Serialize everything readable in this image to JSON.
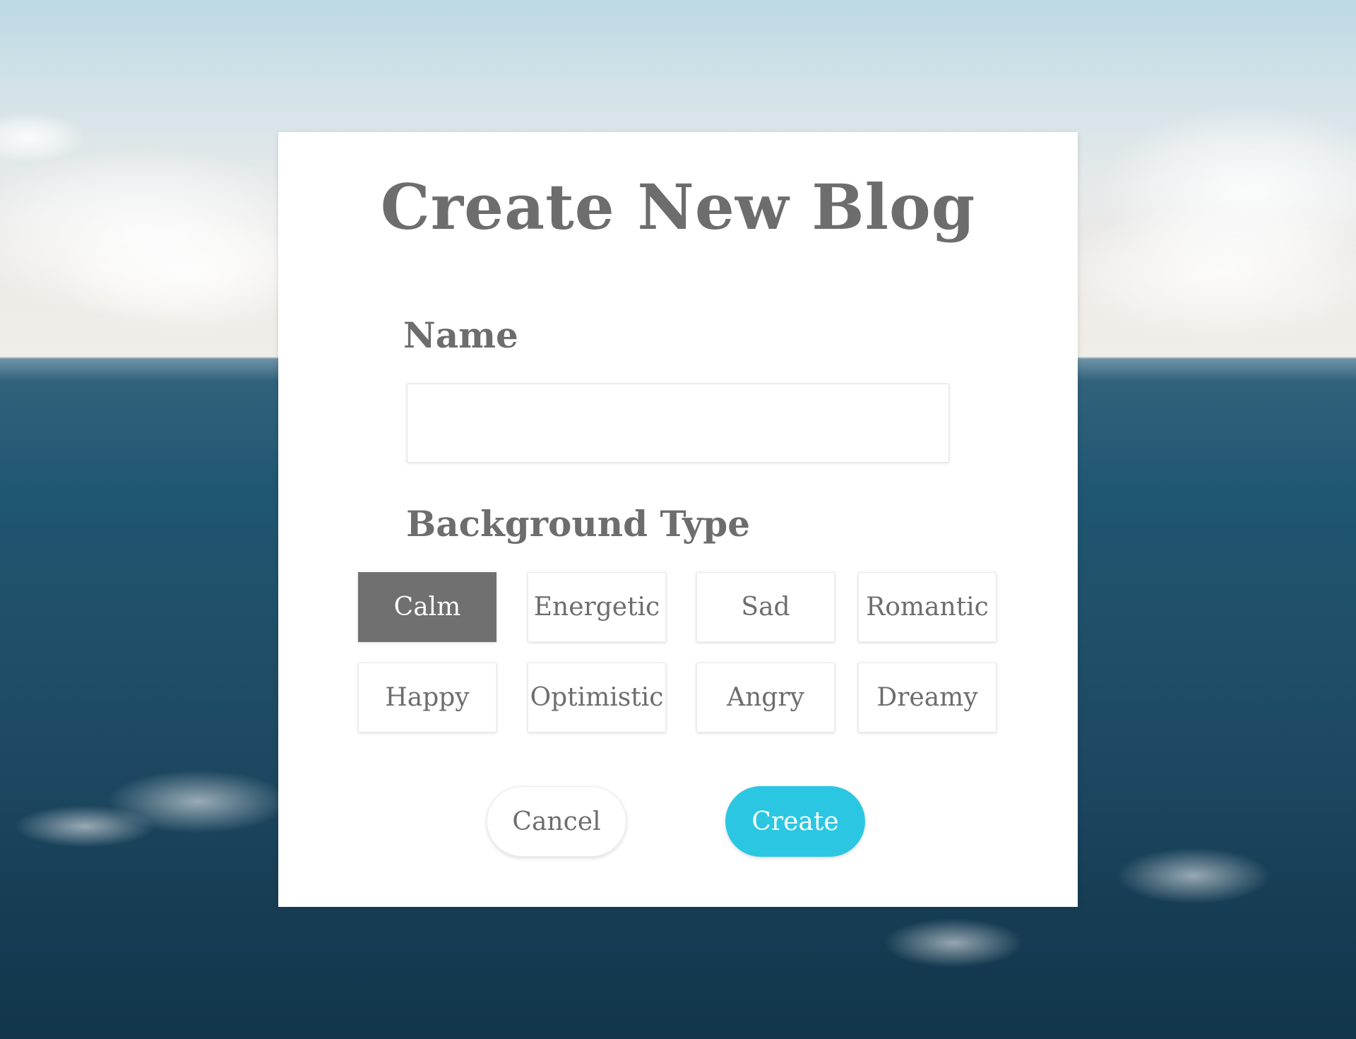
{
  "dialog": {
    "title": "Create New Blog",
    "name_label": "Name",
    "name_value": "",
    "name_placeholder": "",
    "background_label": "Background Type",
    "selected_background": "Calm",
    "background_options": [
      "Calm",
      "Energetic",
      "Sad",
      "Romantic",
      "Happy",
      "Optimistic",
      "Angry",
      "Dreamy"
    ],
    "cancel_label": "Cancel",
    "create_label": "Create"
  },
  "colors": {
    "text": "#6d6d6d",
    "selected_option": "#707070",
    "create_button": "#2bc7e2",
    "modal_background": "#ffffff"
  }
}
